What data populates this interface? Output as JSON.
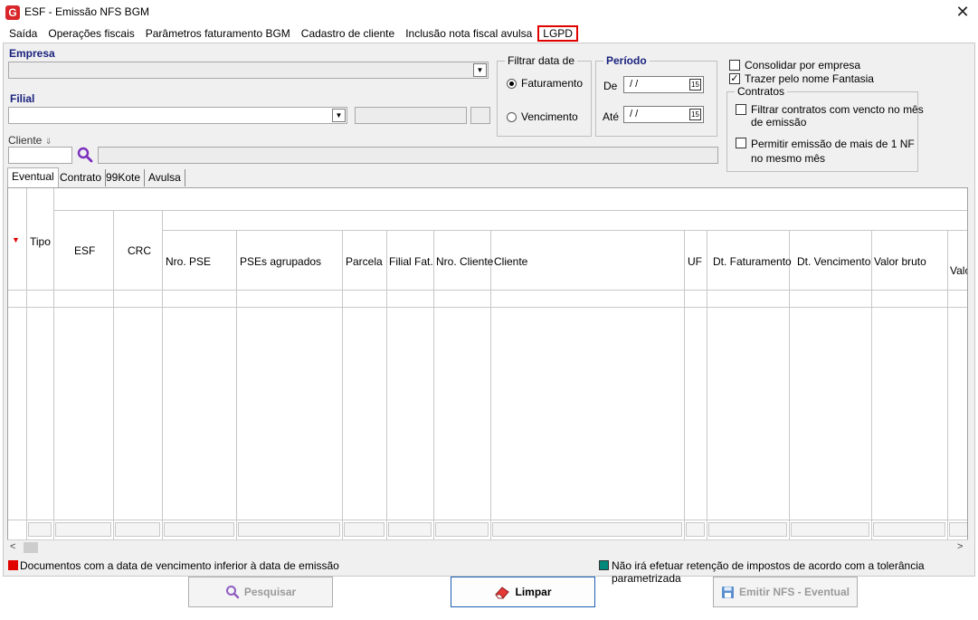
{
  "window": {
    "title": "ESF - Emissão NFS BGM",
    "logo_letter": "G",
    "close_glyph": "✕"
  },
  "menu": [
    {
      "label": "Saída"
    },
    {
      "label": "Operações fiscais"
    },
    {
      "label": "Parâmetros faturamento BGM"
    },
    {
      "label": "Cadastro de cliente"
    },
    {
      "label": "Inclusão nota fiscal avulsa"
    },
    {
      "label": "LGPD"
    }
  ],
  "filters": {
    "empresa_label": "Empresa",
    "filial_label": "Filial",
    "cliente_label": "Cliente",
    "cliente_hint_glyph": "⇓",
    "filtrar_group_title": "Filtrar data de",
    "radio_faturamento": "Faturamento",
    "radio_vencimento": "Vencimento",
    "periodo_title": "Período",
    "de_label": "De",
    "ate_label": "Até",
    "de_value": "/ /",
    "ate_value": "/ /",
    "cal_glyph": "15"
  },
  "options": {
    "consolidar": "Consolidar por empresa",
    "trazer_fantasia": "Trazer pelo nome Fantasia",
    "contratos_title": "Contratos",
    "filtrar_contratos_1": "Filtrar contratos com vencto no mês",
    "filtrar_contratos_2": "de emissão",
    "permitir_1": "Permitir emissão de mais de 1 NF",
    "permitir_2": "no mesmo mês",
    "check_glyph": "✓"
  },
  "tabs": [
    {
      "label": "Eventual"
    },
    {
      "label": "Contrato"
    },
    {
      "label": "99Kote"
    },
    {
      "label": "Avulsa"
    }
  ],
  "grid": {
    "sort_glyph": "▼",
    "columns": {
      "tipo": "Tipo",
      "esf": "ESF",
      "crc": "CRC",
      "nro_pse": "Nro. PSE",
      "pses_agrupados": "PSEs agrupados",
      "parcela": "Parcela",
      "filial_fat": "Filial Fat.",
      "nro_cliente": "Nro. Cliente",
      "cliente": "Cliente",
      "uf": "UF",
      "dt_faturamento": "Dt. Faturamento",
      "dt_vencimento": "Dt. Vencimento",
      "valor_bruto": "Valor bruto",
      "valor_cut": "Valo"
    },
    "scroll_left": "<",
    "scroll_right": ">"
  },
  "legend": {
    "red_text": "Documentos com a data de vencimento inferior à data de emissão",
    "teal_text": "Não irá efetuar retenção de impostos de acordo com a tolerância parametrizada",
    "red_color": "#e00000",
    "teal_color": "#00897b"
  },
  "buttons": {
    "pesquisar": "Pesquisar",
    "limpar": "Limpar",
    "emitir": "Emitir NFS - Eventual"
  }
}
